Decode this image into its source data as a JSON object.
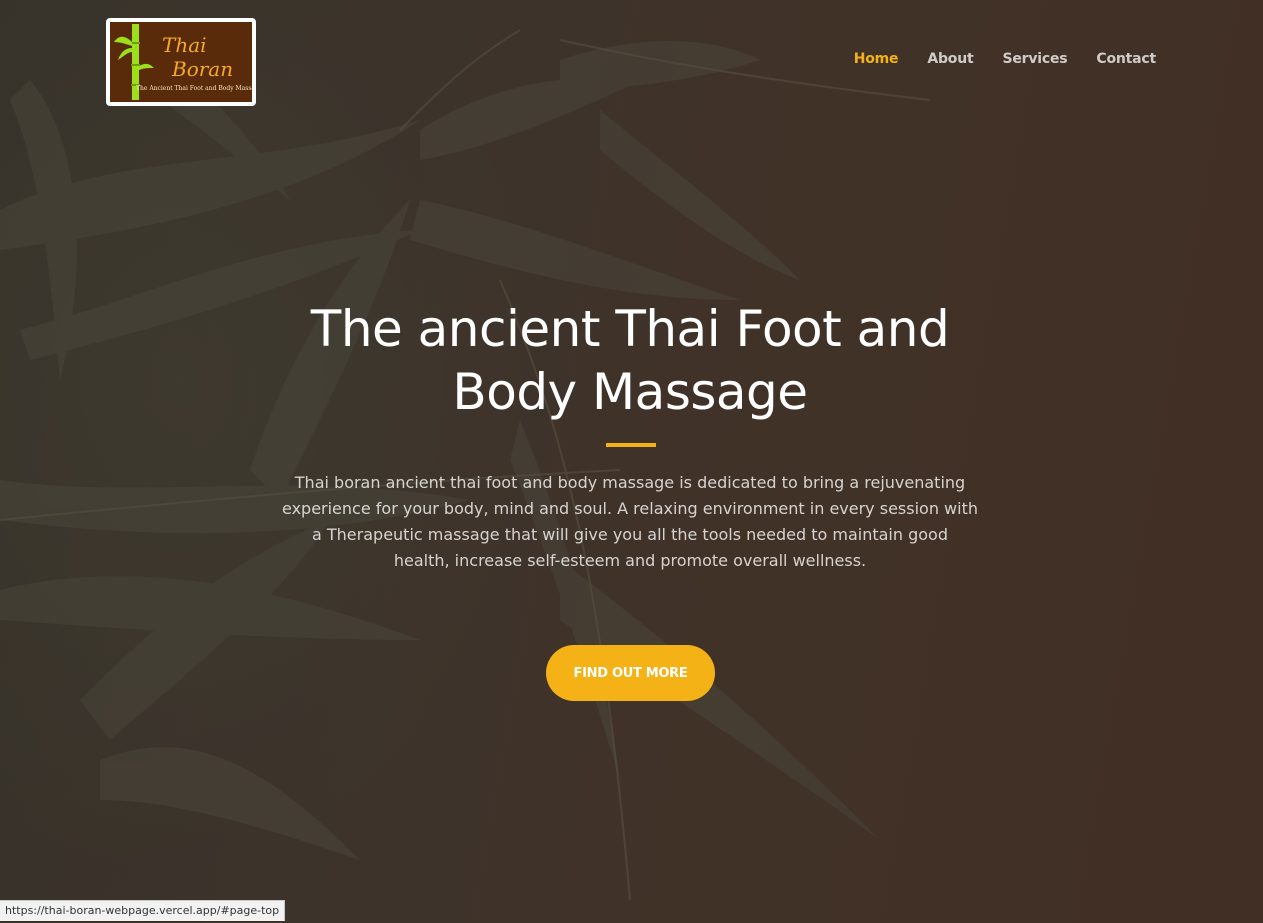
{
  "brand": {
    "logo_word1": "Thai",
    "logo_word2": "Boran",
    "logo_tagline": "The Ancient Thai Foot and Body Massage",
    "logo_bg_color": "#5a2b0a",
    "logo_text_color": "#f4a928",
    "bamboo_color": "#9be01b"
  },
  "nav": {
    "items": [
      {
        "label": "Home",
        "active": true
      },
      {
        "label": "About",
        "active": false
      },
      {
        "label": "Services",
        "active": false
      },
      {
        "label": "Contact",
        "active": false
      }
    ]
  },
  "hero": {
    "title_line1": "The ancient Thai Foot and",
    "title_line2": "Body Massage",
    "description": "Thai boran ancient thai foot and body massage is dedicated to bring a rejuvenating experience for your body, mind and soul. A relaxing environment in every session with a Therapeutic massage that will give you all the tools needed to maintain good health, increase self-esteem and promote overall wellness.",
    "cta_label": "FIND OUT MORE"
  },
  "status_bar": {
    "url": "https://thai-boran-webpage.vercel.app/#page-top"
  },
  "colors": {
    "accent": "#f4b216",
    "background": "#3f332b"
  }
}
